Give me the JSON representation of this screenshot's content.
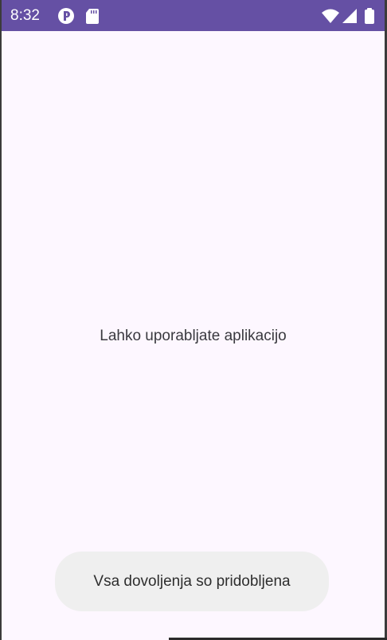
{
  "status_bar": {
    "time": "8:32",
    "background_color": "#6550a4",
    "icons": [
      "app-notification-icon",
      "sd-card-icon",
      "wifi-icon",
      "signal-icon",
      "battery-icon"
    ]
  },
  "main": {
    "message": "Lahko uporabljate aplikacijo",
    "background_color": "#fdf7ff"
  },
  "toast": {
    "text": "Vsa dovoljenja so pridobljena",
    "background_color": "#efefef"
  }
}
